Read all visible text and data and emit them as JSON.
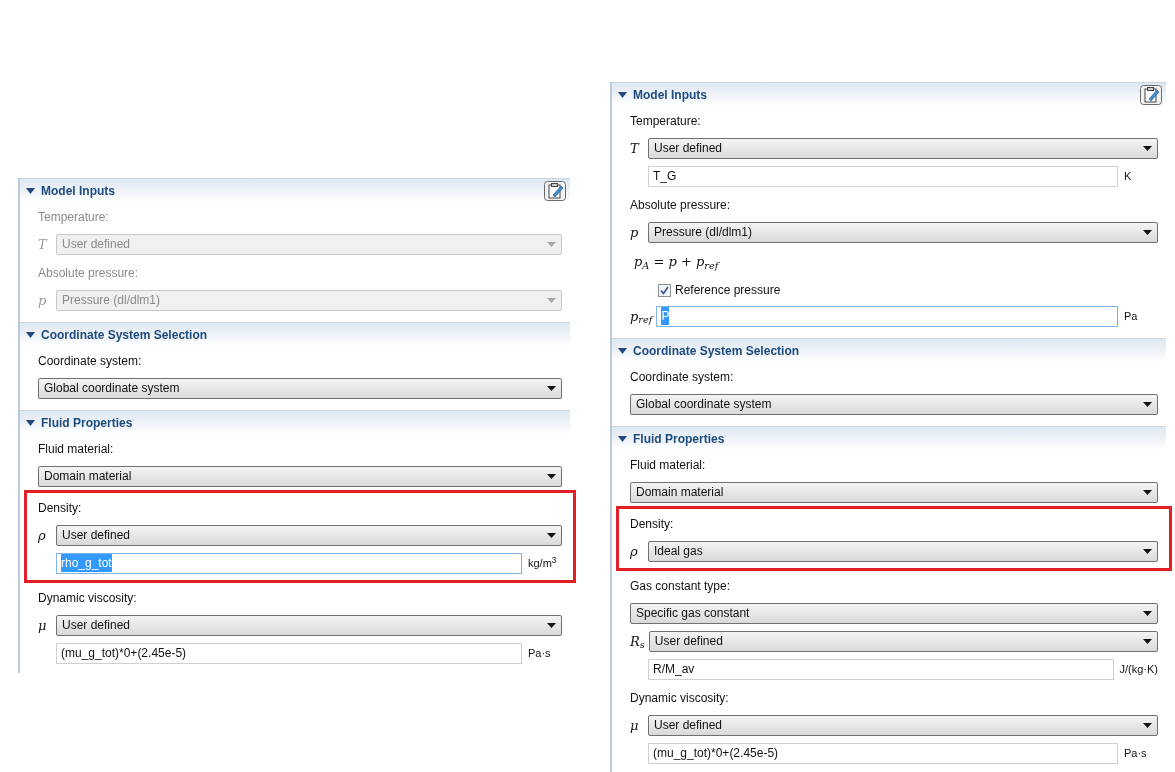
{
  "panels": [
    {
      "sections": [
        {
          "title": "Model Inputs",
          "expanded": true,
          "edit_button": true,
          "rows": [
            {
              "kind": "label",
              "text": "Temperature:",
              "disabled": true
            },
            {
              "kind": "select",
              "symbol": "T",
              "value": "User defined",
              "disabled": true
            },
            {
              "kind": "label",
              "text": "Absolute pressure:",
              "disabled": true
            },
            {
              "kind": "select",
              "symbol": "p",
              "value": "Pressure (dl/dlm1)",
              "disabled": true
            }
          ]
        },
        {
          "title": "Coordinate System Selection",
          "expanded": true,
          "edit_button": false,
          "rows": [
            {
              "kind": "label",
              "text": "Coordinate system:",
              "disabled": false
            },
            {
              "kind": "select",
              "value": "Global coordinate system",
              "disabled": false
            }
          ]
        },
        {
          "title": "Fluid Properties",
          "expanded": true,
          "edit_button": false,
          "rows": [
            {
              "kind": "label",
              "text": "Fluid material:",
              "disabled": false
            },
            {
              "kind": "select",
              "value": "Domain material",
              "disabled": false
            },
            {
              "kind": "highlight",
              "rows": [
                {
                  "kind": "label",
                  "text": "Density:",
                  "disabled": false
                },
                {
                  "kind": "select",
                  "symbol": "ρ",
                  "value": "User defined",
                  "disabled": false
                },
                {
                  "kind": "input",
                  "value": "rho_g_tot",
                  "text_selected": true,
                  "unit": "kg/m$^{3}$"
                }
              ]
            },
            {
              "kind": "label",
              "text": "Dynamic viscosity:",
              "disabled": false
            },
            {
              "kind": "select",
              "symbol": "μ",
              "value": "User defined",
              "disabled": false
            },
            {
              "kind": "input",
              "value": "(mu_g_tot)*0+(2.45e-5)",
              "text_selected": false,
              "unit": "Pa·s"
            }
          ]
        }
      ]
    },
    {
      "sections": [
        {
          "title": "Model Inputs",
          "expanded": true,
          "edit_button": true,
          "rows": [
            {
              "kind": "label",
              "text": "Temperature:",
              "disabled": false
            },
            {
              "kind": "select",
              "symbol": "T",
              "value": "User defined",
              "disabled": false
            },
            {
              "kind": "input",
              "value": "T_G",
              "text_selected": false,
              "unit": "K"
            },
            {
              "kind": "label",
              "text": "Absolute pressure:",
              "disabled": false
            },
            {
              "kind": "select",
              "symbol": "p",
              "value": "Pressure (dl/dlm1)",
              "disabled": false
            },
            {
              "kind": "equation",
              "text": "p$_{A}$ = p + p$_{ref}$"
            },
            {
              "kind": "checkbox",
              "label": "Reference pressure",
              "checked": true
            },
            {
              "kind": "input",
              "symbol": "p$_{ref}$",
              "value": "P",
              "text_selected": true,
              "unit": "Pa"
            }
          ]
        },
        {
          "title": "Coordinate System Selection",
          "expanded": true,
          "edit_button": false,
          "rows": [
            {
              "kind": "label",
              "text": "Coordinate system:",
              "disabled": false
            },
            {
              "kind": "select",
              "value": "Global coordinate system",
              "disabled": false
            }
          ]
        },
        {
          "title": "Fluid Properties",
          "expanded": true,
          "edit_button": false,
          "rows": [
            {
              "kind": "label",
              "text": "Fluid material:",
              "disabled": false
            },
            {
              "kind": "select",
              "value": "Domain material",
              "disabled": false
            },
            {
              "kind": "highlight",
              "rows": [
                {
                  "kind": "label",
                  "text": "Density:",
                  "disabled": false
                },
                {
                  "kind": "select",
                  "symbol": "ρ",
                  "value": "Ideal gas",
                  "disabled": false
                }
              ]
            },
            {
              "kind": "label",
              "text": "Gas constant type:",
              "disabled": false
            },
            {
              "kind": "select",
              "value": "Specific gas constant",
              "disabled": false
            },
            {
              "kind": "select",
              "symbol": "R$_{s}$",
              "value": "User defined",
              "disabled": false
            },
            {
              "kind": "input",
              "value": "R/M_av",
              "text_selected": false,
              "unit": "J/(kg·K)"
            },
            {
              "kind": "label",
              "text": "Dynamic viscosity:",
              "disabled": false
            },
            {
              "kind": "select",
              "symbol": "μ",
              "value": "User defined",
              "disabled": false
            },
            {
              "kind": "input",
              "value": "(mu_g_tot)*0+(2.45e-5)",
              "text_selected": false,
              "unit": "Pa·s"
            }
          ]
        }
      ]
    }
  ]
}
